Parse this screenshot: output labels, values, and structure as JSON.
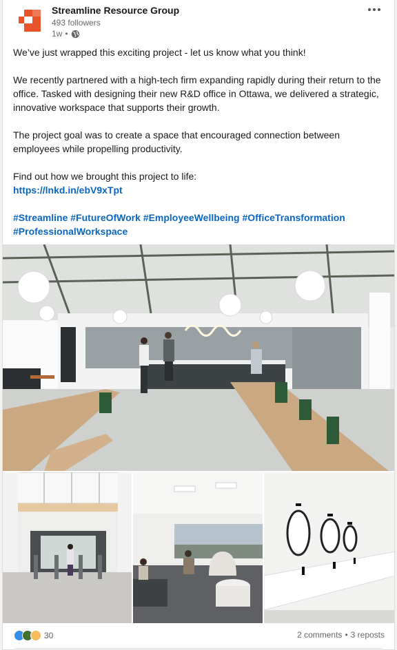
{
  "post": {
    "company_name": "Streamline Resource Group",
    "followers": "493 followers",
    "age": "1w",
    "separator": "•",
    "more_label": "•••",
    "paragraphs": [
      "We’ve just wrapped this exciting project - let us know what you think!",
      "We recently partnered with a high-tech firm expanding rapidly during their return to the office. Tasked with designing their new R&D office in Ottawa, we delivered a strategic, innovative workspace that supports their growth.",
      "The project goal was to create a space that encouraged connection between employees while propelling productivity."
    ],
    "cta_text": "Find out how we brought this project to life:",
    "link": "https://lnkd.in/ebV9xTpt",
    "hashtags": [
      "#Streamline",
      "#FutureOfWork",
      "#EmployeeWellbeing",
      "#OfficeTransformation",
      "#ProfessionalWorkspace"
    ]
  },
  "footer": {
    "reaction_count": "30",
    "comments": "2 comments",
    "dot": "•",
    "reposts": "3 reposts"
  },
  "icons": {
    "logo": "company-logo-icon",
    "globe": "globe-icon",
    "more": "more-options-icon",
    "reactions": [
      "like-icon",
      "celebrate-icon",
      "insightful-icon"
    ]
  },
  "colors": {
    "accent": "#0a66c2",
    "logo_orange": "#e8532b",
    "text_secondary": "#666666"
  }
}
